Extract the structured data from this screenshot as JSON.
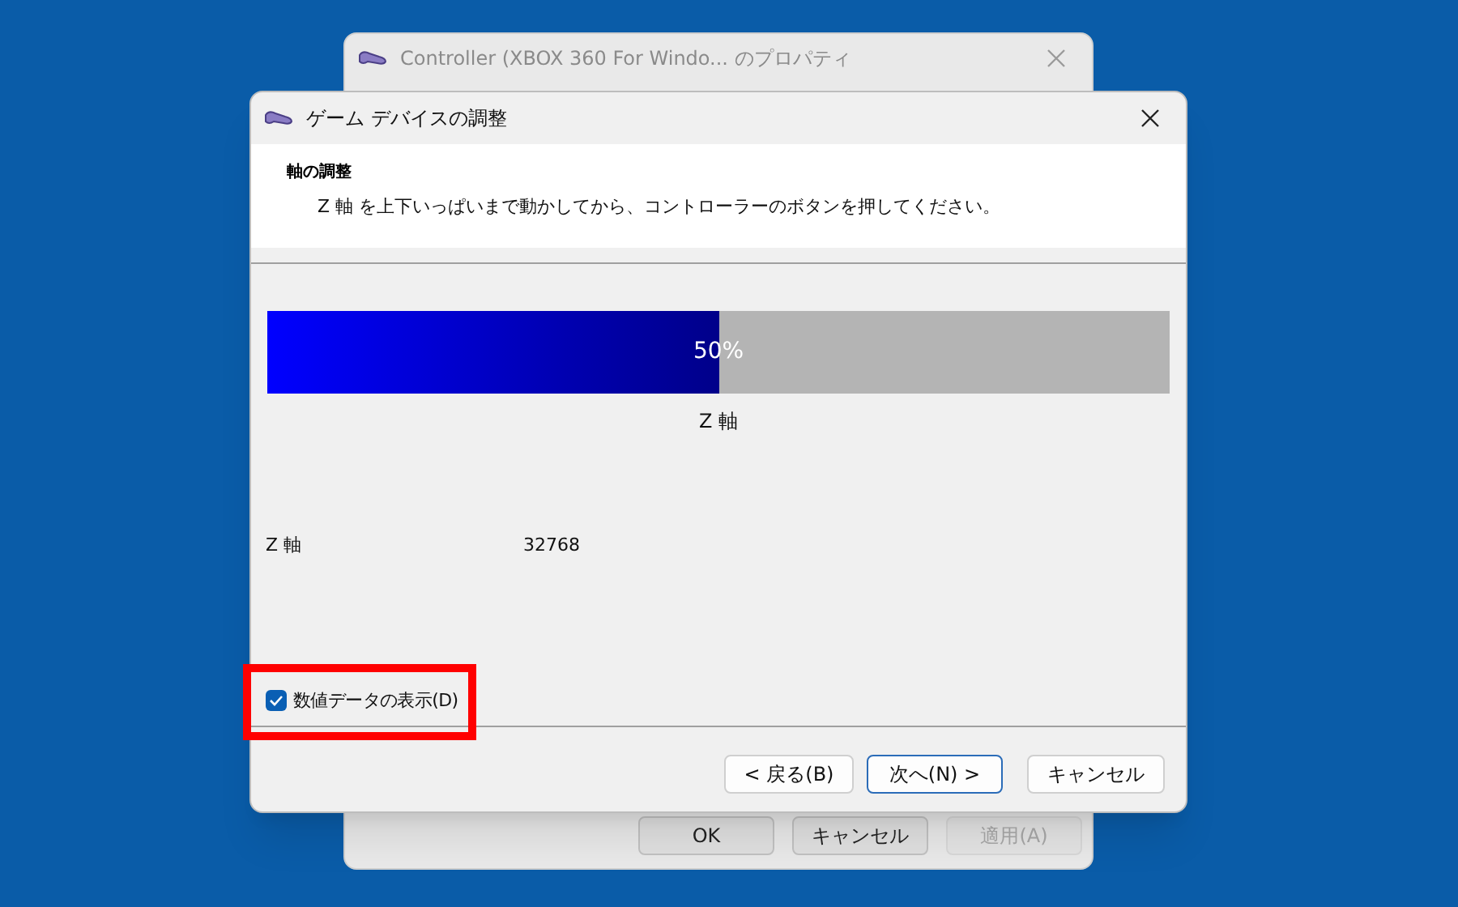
{
  "back_window": {
    "title": "Controller (XBOX 360 For Windo... のプロパティ",
    "buttons": [
      {
        "label": "OK",
        "disabled": false
      },
      {
        "label": "キャンセル",
        "disabled": false
      },
      {
        "label": "適用(A)",
        "disabled": true
      }
    ]
  },
  "dialog": {
    "title": "ゲーム デバイスの調整",
    "heading": "軸の調整",
    "instruction": "Z 軸 を上下いっぱいまで動かしてから、コントローラーのボタンを押してください。",
    "progress": {
      "level": 0.5,
      "label": "50%"
    },
    "axis_label": "Z 軸",
    "readout": {
      "name": "Z 軸",
      "value": "32768"
    },
    "checkbox": {
      "label": "数値データの表示(D)",
      "checked": true
    },
    "buttons": [
      {
        "label": "< 戻る(B)",
        "default": false
      },
      {
        "label": "次へ(N) >",
        "default": true
      },
      {
        "label": "キャンセル",
        "default": false
      }
    ]
  }
}
